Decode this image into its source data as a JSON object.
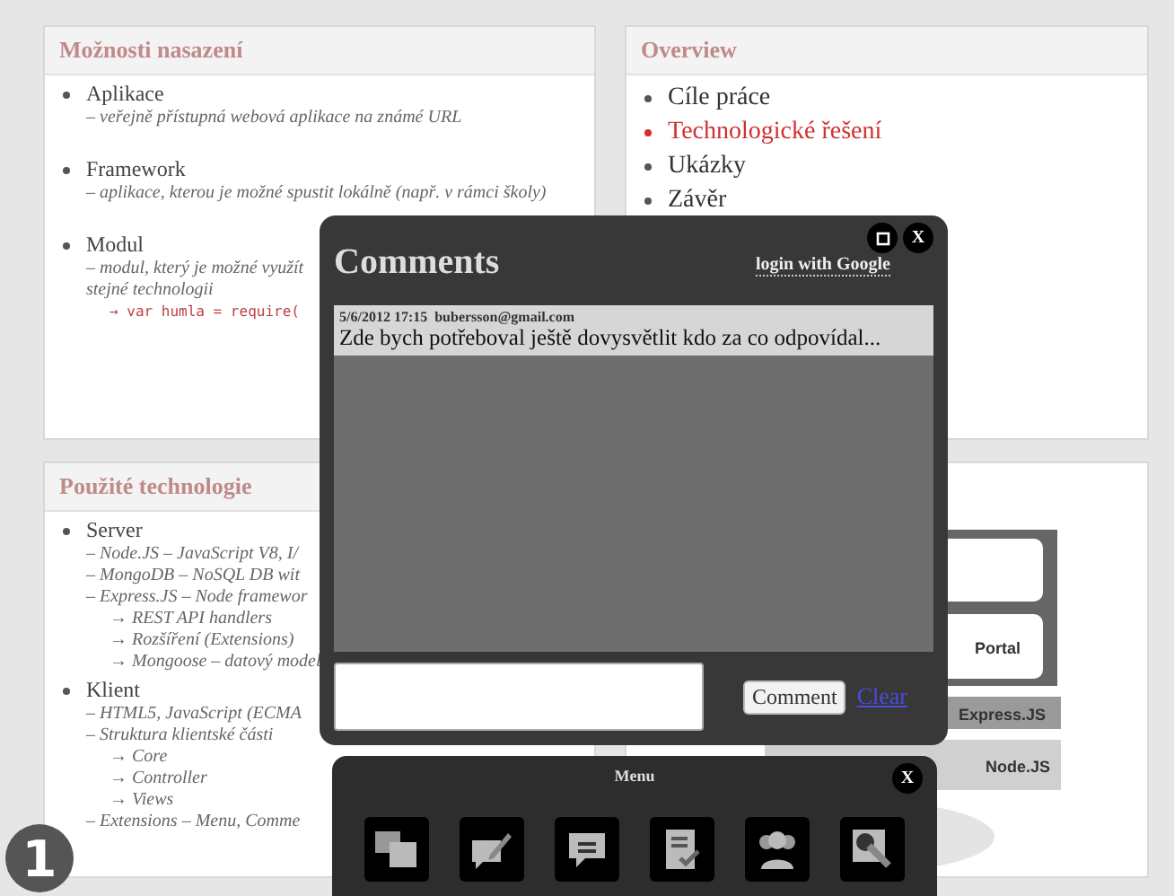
{
  "slides": [
    {
      "kind": "spaced_outline",
      "title": "Možnosti nasazení",
      "items": [
        {
          "label": "Aplikace",
          "lines": [
            {
              "kind": "dash",
              "text": "– veřejně přístupná webová aplikace na známé URL"
            }
          ]
        },
        {
          "label": "Framework",
          "lines": [
            {
              "kind": "dash",
              "text": "– aplikace, kterou je možné spustit lokálně (např. v rámci školy)"
            }
          ]
        },
        {
          "label": "Modul",
          "lines": [
            {
              "kind": "dash",
              "text": "– modul, který je možné využít"
            },
            {
              "kind": "dash",
              "text": "stejné technologii"
            },
            {
              "kind": "code",
              "text": "→ var humla = require("
            }
          ]
        }
      ]
    },
    {
      "kind": "toc",
      "title": "Overview",
      "items": [
        {
          "label": "Cíle práce",
          "selected": false
        },
        {
          "label": "Technologické řešení",
          "selected": true
        },
        {
          "label": "Ukázky",
          "selected": false
        },
        {
          "label": "Závěr",
          "selected": false
        }
      ]
    },
    {
      "kind": "outline",
      "title": "Použité technologie",
      "items": [
        {
          "label": "Server",
          "lines": [
            {
              "kind": "dash",
              "text": "– Node.JS – JavaScript V8, I/"
            },
            {
              "kind": "dash",
              "text": "– MongoDB – NoSQL DB wit"
            },
            {
              "kind": "dash",
              "text": "– Express.JS – Node framewor"
            },
            {
              "kind": "arrow",
              "text": "→ REST API handlers"
            },
            {
              "kind": "arrow",
              "text": "→ Rozšíření (Extensions)"
            },
            {
              "kind": "arrow",
              "text": "→ Mongoose – datový model"
            }
          ]
        },
        {
          "label": "Klient",
          "lines": [
            {
              "kind": "dash",
              "text": "– HTML5, JavaScript (ECMA"
            },
            {
              "kind": "dash",
              "text": "– Struktura klientské části"
            },
            {
              "kind": "arrow",
              "text": "→ Core"
            },
            {
              "kind": "arrow",
              "text": "→ Controller"
            },
            {
              "kind": "arrow",
              "text": "→ Views"
            },
            {
              "kind": "dash",
              "text": "– Extensions – Menu, Comme"
            }
          ]
        }
      ]
    },
    {
      "kind": "diagram",
      "labels": [
        "Portal",
        "Express.JS",
        "Node.JS"
      ]
    }
  ],
  "comments": {
    "title": "Comments",
    "close_label": "X",
    "login_link": "login with Google",
    "entries": [
      {
        "date": "5/6/2012 17:15",
        "author": "bubersson@gmail.com",
        "text": "Zde bych potřeboval ještě dovysvětlit kdo za co odpovídal..."
      }
    ],
    "comment_button": "Comment",
    "clear_link": "Clear"
  },
  "menu": {
    "title": "Menu",
    "close_label": "X"
  },
  "slide_badge": "1"
}
